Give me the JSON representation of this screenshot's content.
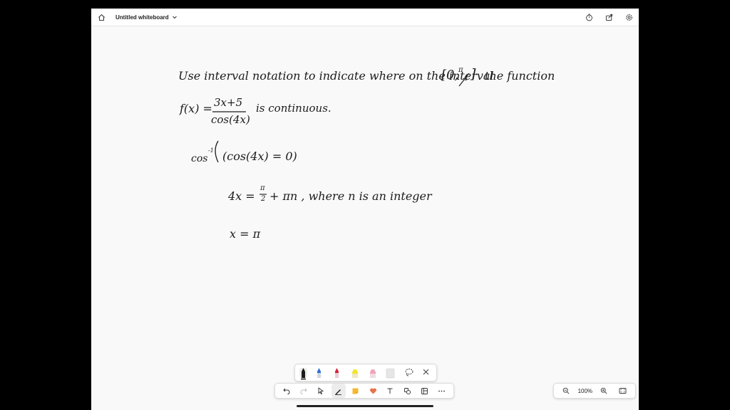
{
  "header": {
    "title": "Untitled whiteboard",
    "icons": [
      "home-icon",
      "chevron-down-icon",
      "timer-icon",
      "share-icon",
      "settings-gear-icon"
    ]
  },
  "board": {
    "line1_text": "Use interval notation to indicate where on the interval",
    "line1_interval_left": "[0,",
    "line1_interval_pi": "π",
    "line1_interval_den": "4",
    "line1_interval_right": "]",
    "line1_tail": "the function",
    "fx_label": "f(x) =",
    "fx_numerator": "3x+5",
    "fx_denominator": "cos(4x)",
    "fx_tail": "is continuous.",
    "step1_prefix": "cos",
    "step1_exp": "-1",
    "step1_body": "(cos(4x) = 0)",
    "step2_left": "4x =",
    "step2_frac_num": "π",
    "step2_frac_den": "2",
    "step2_tail": "+ πn , where n is an integer",
    "step3": "x = π"
  },
  "pen_tray": {
    "colors": [
      "#1a1a1a",
      "#2f6fd6",
      "#d6243c",
      "#f3e42b",
      "#f2a3b8",
      "#e6e6e6"
    ],
    "icons": [
      "black-pen-icon",
      "blue-pen-icon",
      "red-pen-icon",
      "yellow-highlighter-icon",
      "pink-highlighter-icon",
      "eraser-icon",
      "lasso-icon",
      "close-icon"
    ]
  },
  "toolbar": {
    "icons": [
      "undo-icon",
      "redo-icon",
      "select-pointer-icon",
      "pen-icon",
      "sticky-note-icon",
      "reaction-heart-icon",
      "text-icon",
      "shapes-icon",
      "template-icon",
      "more-icon"
    ],
    "accent": "#e8734a"
  },
  "zoom": {
    "level": "100%",
    "icons": [
      "zoom-out-icon",
      "zoom-in-icon",
      "fit-screen-icon"
    ]
  }
}
